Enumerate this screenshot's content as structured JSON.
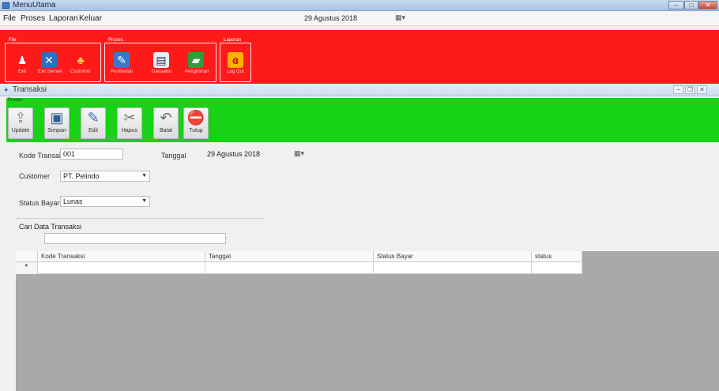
{
  "window": {
    "title": "MenuUtama"
  },
  "menubar": {
    "items": [
      "File",
      "Proses",
      "Laporan",
      "Keluar"
    ],
    "date": "29 Agustus 2018"
  },
  "ribbon": {
    "groups": [
      {
        "label": "File",
        "tools": [
          "Exit",
          "Exit Semen",
          "Customer"
        ]
      },
      {
        "label": "Proses",
        "tools": [
          "Pembelian",
          "Transaksi",
          "Pengiriman"
        ]
      },
      {
        "label": "Laporan",
        "tools": [
          "Log Out"
        ]
      }
    ]
  },
  "inner": {
    "title": "Transaksi"
  },
  "toolbar": {
    "group_label": "Proses",
    "buttons": [
      "Update",
      "Simpan",
      "Edit",
      "Hapus",
      "Batal",
      "Tutup"
    ]
  },
  "form": {
    "kode_label": "Kode Transaksi",
    "kode_value": "001",
    "tanggal_label": "Tanggal",
    "tanggal_value": "29 Agustus 2018",
    "customer_label": "Customer",
    "customer_value": "PT. Pelindo",
    "status_label": "Status Bayar",
    "status_value": "Lunas",
    "search_label": "Cari Data Transaksi",
    "search_value": ""
  },
  "grid": {
    "columns": [
      "Kode Transaksi",
      "Tanggal",
      "Status Bayar",
      "status"
    ],
    "new_row_marker": "*"
  },
  "colors": {
    "ribbon": "#ff1a1a",
    "toolbar": "#17d217",
    "grid_bg": "#a9a9a9"
  }
}
